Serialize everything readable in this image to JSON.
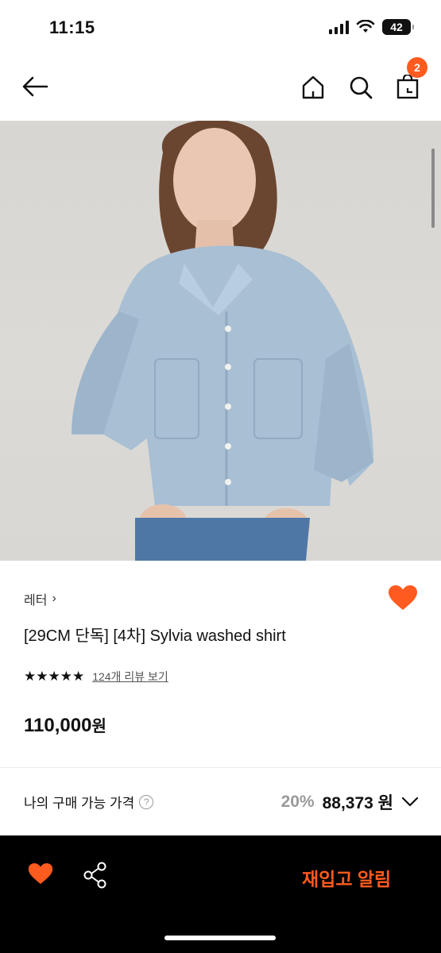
{
  "status_bar": {
    "time": "11:15",
    "battery": "42"
  },
  "nav": {
    "cart_count": "2"
  },
  "product": {
    "brand": "레터",
    "brand_arrow": "›",
    "title": "[29CM 단독] [4차] Sylvia washed shirt",
    "stars": "★★★★★",
    "review_link": "124개 리뷰 보기",
    "price": "110,000",
    "price_unit": "원"
  },
  "my_price": {
    "label": "나의 구매 가능 가격",
    "help": "?",
    "discount_percent": "20%",
    "discount_price": "88,373 원"
  },
  "bottom": {
    "restock_label": "재입고 알림"
  },
  "colors": {
    "accent": "#ff5a1f",
    "bottom_bar": "#000000"
  }
}
